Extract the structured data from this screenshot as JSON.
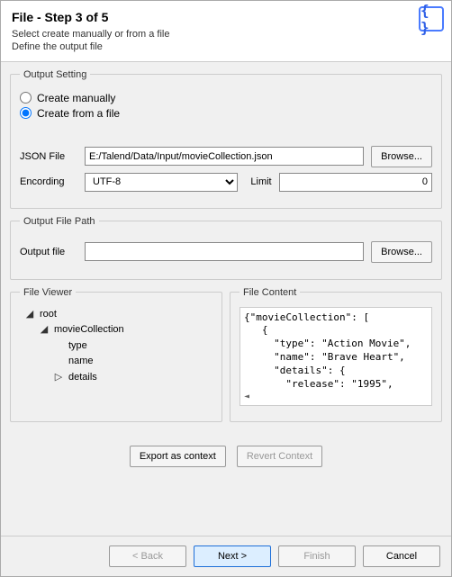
{
  "header": {
    "title": "File - Step 3 of 5",
    "subtitle_line1": "Select create manually or from a file",
    "subtitle_line2": "Define the output file",
    "icon_glyph": "{ }"
  },
  "output_setting": {
    "legend": "Output Setting",
    "radio_manual": "Create manually",
    "radio_file": "Create from a file",
    "json_file_label": "JSON File",
    "json_file_value": "E:/Talend/Data/Input/movieCollection.json",
    "browse_label": "Browse...",
    "encoding_label": "Encording",
    "encoding_value": "UTF-8",
    "limit_label": "Limit",
    "limit_value": "0"
  },
  "output_path": {
    "legend": "Output File Path",
    "label": "Output file",
    "value": "",
    "browse_label": "Browse..."
  },
  "file_viewer": {
    "legend": "File Viewer",
    "nodes": {
      "root": "root",
      "movieCollection": "movieCollection",
      "type": "type",
      "name": "name",
      "details": "details"
    }
  },
  "file_content": {
    "legend": "File Content",
    "text": "{\"movieCollection\": [\n   {\n     \"type\": \"Action Movie\",\n     \"name\": \"Brave Heart\",\n     \"details\": {\n       \"release\": \"1995\","
  },
  "context": {
    "export": "Export as context",
    "revert": "Revert Context"
  },
  "footer": {
    "back": "< Back",
    "next": "Next >",
    "finish": "Finish",
    "cancel": "Cancel"
  }
}
